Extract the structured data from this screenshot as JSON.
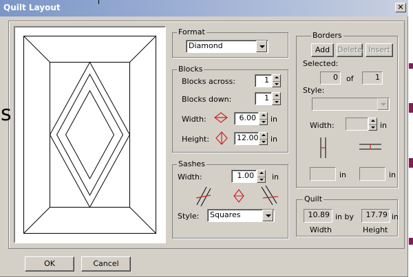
{
  "window": {
    "title": "Quilt Layout",
    "close_glyph": "✕"
  },
  "side_glyph": "s",
  "format": {
    "legend": "Format",
    "selected": "Diamond"
  },
  "blocks": {
    "legend": "Blocks",
    "across_label": "Blocks across:",
    "across_value": "1",
    "down_label": "Blocks down:",
    "down_value": "1",
    "width_label": "Width:",
    "width_value": "6.00",
    "width_unit": "in",
    "height_label": "Height:",
    "height_value": "12.00",
    "height_unit": "in"
  },
  "sashes": {
    "legend": "Sashes",
    "width_label": "Width:",
    "width_value": "1.00",
    "width_unit": "in",
    "style_label": "Style:",
    "style_selected": "Squares"
  },
  "borders": {
    "legend": "Borders",
    "add_label": "Add",
    "delete_label": "Delete",
    "insert_label": "Insert",
    "selected_label": "Selected:",
    "selected_value": "0",
    "of_label": "of",
    "total_value": "1",
    "style_label": "Style:",
    "style_selected": "",
    "width_label": "Width:",
    "width_value": "",
    "width_unit": "in",
    "vert_value": "",
    "vert_unit": "in",
    "horiz_value": "",
    "horiz_unit": "in"
  },
  "quilt": {
    "legend": "Quilt",
    "width_value": "10.89",
    "by_label": "in by",
    "height_value": "17.79",
    "unit": "in",
    "width_caption": "Width",
    "height_caption": "Height"
  },
  "buttons": {
    "ok": "OK",
    "cancel": "Cancel"
  },
  "colors": {
    "title_bar": "#7a96c8",
    "dialog_face": "#d4d0c8",
    "diamond_icon": "#cc2222",
    "sash_icon": "#cc2222"
  }
}
